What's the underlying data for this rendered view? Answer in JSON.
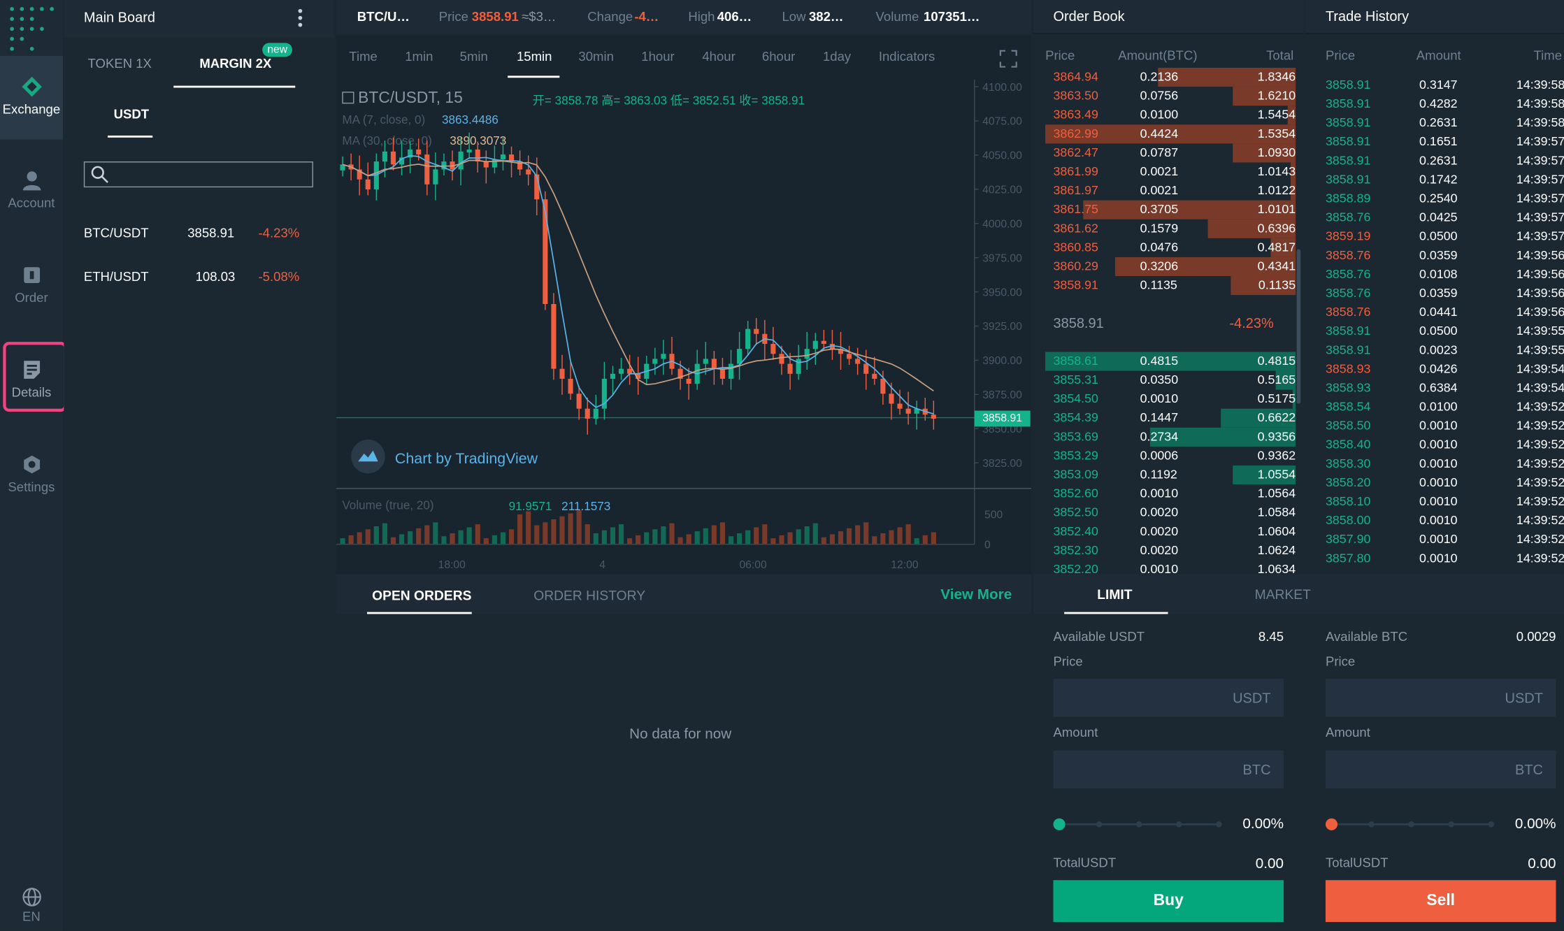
{
  "nav": {
    "items": [
      {
        "label": "Exchange",
        "icon": "exchange-icon"
      },
      {
        "label": "Account",
        "icon": "user-icon"
      },
      {
        "label": "Order",
        "icon": "order-icon"
      },
      {
        "label": "Details",
        "icon": "document-icon"
      },
      {
        "label": "Settings",
        "icon": "gear-icon"
      }
    ],
    "lang": "EN"
  },
  "board": {
    "title": "Main Board",
    "tabs": [
      "TOKEN 1X",
      "MARGIN 2X"
    ],
    "new_badge": "new",
    "quote": "USDT",
    "search_placeholder": "",
    "markets": [
      {
        "pair": "BTC/USDT",
        "price": "3858.91",
        "change": "-4.23%"
      },
      {
        "pair": "ETH/USDT",
        "price": "108.03",
        "change": "-5.08%"
      }
    ]
  },
  "ticker": {
    "pair": "BTC/U…",
    "price_label": "Price",
    "price": "3858.91",
    "price_usd": "≈$3…",
    "change_label": "Change",
    "change": "-4…",
    "high_label": "High",
    "high": "406…",
    "low_label": "Low",
    "low": "382…",
    "volume_label": "Volume",
    "volume": "107351…"
  },
  "chart": {
    "timeframes": [
      "Time",
      "1min",
      "5min",
      "15min",
      "30min",
      "1hour",
      "4hour",
      "6hour",
      "1day",
      "Indicators"
    ],
    "active_timeframe": "15min",
    "symbol": "BTC/USDT, 15",
    "ohlc": "开= 3858.78  高= 3863.03  低= 3852.51  收= 3858.91",
    "ma7_label": "MA (7, close, 0)",
    "ma7_value": "3863.4486",
    "ma30_label": "MA (30, close, 0)",
    "ma30_value": "3890.3073",
    "watermark": "Chart by TradingView",
    "price_axis": [
      "4100.00",
      "4075.00",
      "4050.00",
      "4025.00",
      "4000.00",
      "3975.00",
      "3950.00",
      "3925.00",
      "3900.00",
      "3875.00",
      "3850.00",
      "3825.00"
    ],
    "last_price": "3858.91",
    "volume_label": "Volume (true, 20)",
    "volume_v1": "91.9571",
    "volume_v2": "211.1573",
    "volume_axis": [
      "500",
      "0"
    ],
    "time_axis": [
      "18:00",
      "4",
      "06:00",
      "12:00"
    ]
  },
  "orders": {
    "tabs": [
      "OPEN ORDERS",
      "ORDER HISTORY"
    ],
    "view_more": "View More",
    "empty": "No data for now"
  },
  "orderbook": {
    "title": "Order Book",
    "cols": [
      "Price",
      "Amount(BTC)",
      "Total"
    ],
    "asks": [
      {
        "price": "3864.94",
        "amount": "0.2136",
        "total": "1.8346",
        "depth": 0.55
      },
      {
        "price": "3863.50",
        "amount": "0.0756",
        "total": "1.6210",
        "depth": 0.25
      },
      {
        "price": "3863.49",
        "amount": "0.0100",
        "total": "1.5454",
        "depth": 0.03
      },
      {
        "price": "3862.99",
        "amount": "0.4424",
        "total": "1.5354",
        "depth": 1.0
      },
      {
        "price": "3862.47",
        "amount": "0.0787",
        "total": "1.0930",
        "depth": 0.25
      },
      {
        "price": "3861.99",
        "amount": "0.0021",
        "total": "1.0143",
        "depth": 0.02
      },
      {
        "price": "3861.97",
        "amount": "0.0021",
        "total": "1.0122",
        "depth": 0.02
      },
      {
        "price": "3861.75",
        "amount": "0.3705",
        "total": "1.0101",
        "depth": 0.85
      },
      {
        "price": "3861.62",
        "amount": "0.1579",
        "total": "0.6396",
        "depth": 0.35
      },
      {
        "price": "3860.85",
        "amount": "0.0476",
        "total": "0.4817",
        "depth": 0.1
      },
      {
        "price": "3860.29",
        "amount": "0.3206",
        "total": "0.4341",
        "depth": 0.72
      },
      {
        "price": "3858.91",
        "amount": "0.1135",
        "total": "0.1135",
        "depth": 0.26
      }
    ],
    "mid_price": "3858.91",
    "mid_change": "-4.23%",
    "bids": [
      {
        "price": "3858.61",
        "amount": "0.4815",
        "total": "0.4815",
        "depth": 1.0
      },
      {
        "price": "3855.31",
        "amount": "0.0350",
        "total": "0.5165",
        "depth": 0.08
      },
      {
        "price": "3854.50",
        "amount": "0.0010",
        "total": "0.5175",
        "depth": 0.01
      },
      {
        "price": "3854.39",
        "amount": "0.1447",
        "total": "0.6622",
        "depth": 0.3
      },
      {
        "price": "3853.69",
        "amount": "0.2734",
        "total": "0.9356",
        "depth": 0.58
      },
      {
        "price": "3853.29",
        "amount": "0.0006",
        "total": "0.9362",
        "depth": 0.0
      },
      {
        "price": "3853.09",
        "amount": "0.1192",
        "total": "1.0554",
        "depth": 0.25
      },
      {
        "price": "3852.60",
        "amount": "0.0010",
        "total": "1.0564",
        "depth": 0.0
      },
      {
        "price": "3852.50",
        "amount": "0.0020",
        "total": "1.0584",
        "depth": 0.0
      },
      {
        "price": "3852.40",
        "amount": "0.0020",
        "total": "1.0604",
        "depth": 0.0
      },
      {
        "price": "3852.30",
        "amount": "0.0020",
        "total": "1.0624",
        "depth": 0.0
      },
      {
        "price": "3852.20",
        "amount": "0.0010",
        "total": "1.0634",
        "depth": 0.0
      }
    ]
  },
  "trades": {
    "title": "Trade History",
    "cols": [
      "Price",
      "Amount",
      "Time"
    ],
    "rows": [
      {
        "price": "3858.91",
        "amount": "0.3147",
        "time": "14:39:58",
        "side": "buy"
      },
      {
        "price": "3858.91",
        "amount": "0.4282",
        "time": "14:39:58",
        "side": "buy"
      },
      {
        "price": "3858.91",
        "amount": "0.2631",
        "time": "14:39:58",
        "side": "buy"
      },
      {
        "price": "3858.91",
        "amount": "0.1651",
        "time": "14:39:57",
        "side": "buy"
      },
      {
        "price": "3858.91",
        "amount": "0.2631",
        "time": "14:39:57",
        "side": "buy"
      },
      {
        "price": "3858.91",
        "amount": "0.1742",
        "time": "14:39:57",
        "side": "buy"
      },
      {
        "price": "3858.89",
        "amount": "0.2540",
        "time": "14:39:57",
        "side": "buy"
      },
      {
        "price": "3858.76",
        "amount": "0.0425",
        "time": "14:39:57",
        "side": "buy"
      },
      {
        "price": "3859.19",
        "amount": "0.0500",
        "time": "14:39:57",
        "side": "sell"
      },
      {
        "price": "3858.76",
        "amount": "0.0359",
        "time": "14:39:56",
        "side": "sell"
      },
      {
        "price": "3858.76",
        "amount": "0.0108",
        "time": "14:39:56",
        "side": "buy"
      },
      {
        "price": "3858.76",
        "amount": "0.0359",
        "time": "14:39:56",
        "side": "buy"
      },
      {
        "price": "3858.76",
        "amount": "0.0441",
        "time": "14:39:56",
        "side": "sell"
      },
      {
        "price": "3858.91",
        "amount": "0.0500",
        "time": "14:39:55",
        "side": "buy"
      },
      {
        "price": "3858.91",
        "amount": "0.0023",
        "time": "14:39:55",
        "side": "buy"
      },
      {
        "price": "3858.93",
        "amount": "0.0426",
        "time": "14:39:54",
        "side": "sell"
      },
      {
        "price": "3858.93",
        "amount": "0.6384",
        "time": "14:39:54",
        "side": "buy"
      },
      {
        "price": "3858.54",
        "amount": "0.0100",
        "time": "14:39:52",
        "side": "buy"
      },
      {
        "price": "3858.50",
        "amount": "0.0010",
        "time": "14:39:52",
        "side": "buy"
      },
      {
        "price": "3858.40",
        "amount": "0.0010",
        "time": "14:39:52",
        "side": "buy"
      },
      {
        "price": "3858.30",
        "amount": "0.0010",
        "time": "14:39:52",
        "side": "buy"
      },
      {
        "price": "3858.20",
        "amount": "0.0010",
        "time": "14:39:52",
        "side": "buy"
      },
      {
        "price": "3858.10",
        "amount": "0.0010",
        "time": "14:39:52",
        "side": "buy"
      },
      {
        "price": "3858.00",
        "amount": "0.0010",
        "time": "14:39:52",
        "side": "buy"
      },
      {
        "price": "3857.90",
        "amount": "0.0010",
        "time": "14:39:52",
        "side": "buy"
      },
      {
        "price": "3857.80",
        "amount": "0.0010",
        "time": "14:39:52",
        "side": "buy"
      }
    ]
  },
  "trade_form": {
    "tabs": [
      "LIMIT",
      "MARKET"
    ],
    "buy": {
      "available_label": "Available USDT",
      "available": "8.45",
      "price_label": "Price",
      "price_unit": "USDT",
      "amount_label": "Amount",
      "amount_unit": "BTC",
      "percent": "0.00%",
      "total_label": "TotalUSDT",
      "total": "0.00",
      "button": "Buy"
    },
    "sell": {
      "available_label": "Available BTC",
      "available": "0.0029",
      "price_label": "Price",
      "price_unit": "USDT",
      "amount_label": "Amount",
      "amount_unit": "BTC",
      "percent": "0.00%",
      "total_label": "TotalUSDT",
      "total": "0.00",
      "button": "Sell"
    }
  },
  "colors": {
    "buy": "#14b38c",
    "sell": "#ef5f40",
    "highlight": "#f0437f"
  }
}
